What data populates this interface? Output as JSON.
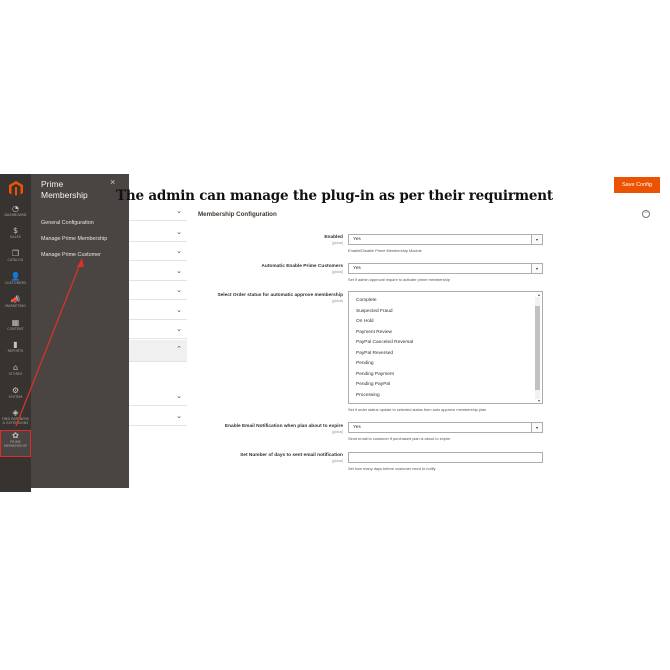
{
  "headline": "The admin can manage the plug-in as per their requirment",
  "sidebar": {
    "items": [
      {
        "label": "DASHBOARD",
        "icon": "dashboard-icon",
        "glyph": "◔"
      },
      {
        "label": "SALES",
        "icon": "dollar-icon",
        "glyph": "$"
      },
      {
        "label": "CATALOG",
        "icon": "cube-icon",
        "glyph": "❒"
      },
      {
        "label": "CUSTOMERS",
        "icon": "person-icon",
        "glyph": "👤"
      },
      {
        "label": "MARKETING",
        "icon": "megaphone-icon",
        "glyph": "📣"
      },
      {
        "label": "CONTENT",
        "icon": "layout-icon",
        "glyph": "▦"
      },
      {
        "label": "REPORTS",
        "icon": "bar-chart-icon",
        "glyph": "▮"
      },
      {
        "label": "STORES",
        "icon": "store-icon",
        "glyph": "⌂"
      },
      {
        "label": "SYSTEM",
        "icon": "gear-icon",
        "glyph": "⚙"
      },
      {
        "label": "FIND PARTNERS & EXTENSIONS",
        "icon": "puzzle-icon",
        "glyph": "◈"
      }
    ],
    "prime": {
      "label": "PRIME MEMBERSHIP",
      "icon": "prime-icon",
      "glyph": "✿"
    }
  },
  "flyout": {
    "title": "Prime Membership",
    "close": "×",
    "menu": [
      "General Configuration",
      "Manage Prime Membership",
      "Manage Prime Customer"
    ]
  },
  "toolbar": {
    "save_label": "Save Config"
  },
  "config": {
    "section_title": "Membership Configuration",
    "collapse": "−",
    "scope": "[global]",
    "enabled": {
      "label": "Enabled",
      "value": "Yes",
      "note": "Enable/Disable Prime Membership Module"
    },
    "auto_enable": {
      "label": "Automatic Enable Prime Customers",
      "value": "Yes",
      "note": "Set if admin approval require to activate prime membership"
    },
    "order_status": {
      "label": "Select Order status for automatic approve membership",
      "options": [
        "Complete",
        "Suspected Fraud",
        "On Hold",
        "Payment Review",
        "PayPal Canceled Reversal",
        "PayPal Reversed",
        "Pending",
        "Pending Payment",
        "Pending PayPal",
        "Processing"
      ],
      "note": "Set if order status update to selected status then auto approve membership plan"
    },
    "email_notify": {
      "label": "Enable Email Notification when plan about to expire",
      "value": "Yes",
      "note": "Send email to customer if purchased plan is about to expire"
    },
    "days": {
      "label": "Set Number of days to sent email notification",
      "value": "",
      "note": "Set how many days before customer need to notify"
    }
  },
  "colors": {
    "accent": "#eb5202",
    "sidebar": "#373330",
    "flyout": "#4a4542",
    "highlight": "#e02b27"
  }
}
